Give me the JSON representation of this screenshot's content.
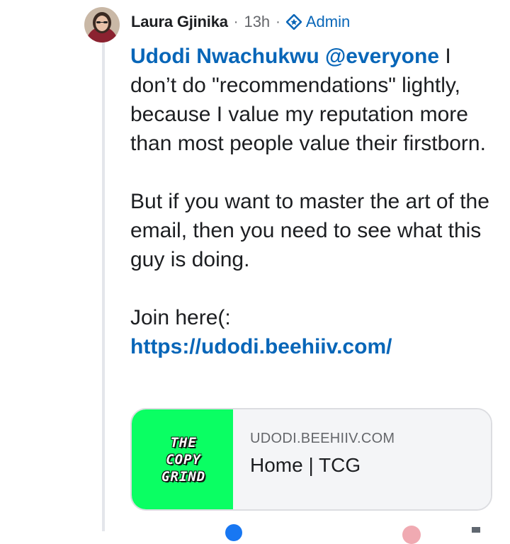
{
  "post": {
    "author": "Laura Gjinika",
    "separator_1": "·",
    "time_ago": "13h",
    "separator_2": "·",
    "badge_label": "Admin",
    "badge_icon": "admin-shield-icon",
    "avatar_icon": "user-avatar-photo"
  },
  "body": {
    "mention_name": "Udodi Nwachukwu @everyone",
    "line_1_rest": " I don’t do \"recommendations\" lightly, because I value my reputation more than most people value their firstborn.",
    "paragraph_2": "But if you want to master the art of the email, then you need to see what this guy is doing.",
    "paragraph_3": "Join here(:",
    "link_text": "https://udodi.beehiiv.com/"
  },
  "link_preview": {
    "thumbnail_lines": [
      "THE",
      "COPY",
      "GRIND"
    ],
    "domain": "UDODI.BEEHIIV.COM",
    "title": "Home | TCG"
  },
  "colors": {
    "link_blue": "#0866b8",
    "meta_gray": "#65676b",
    "thumb_green": "#0aff63"
  }
}
